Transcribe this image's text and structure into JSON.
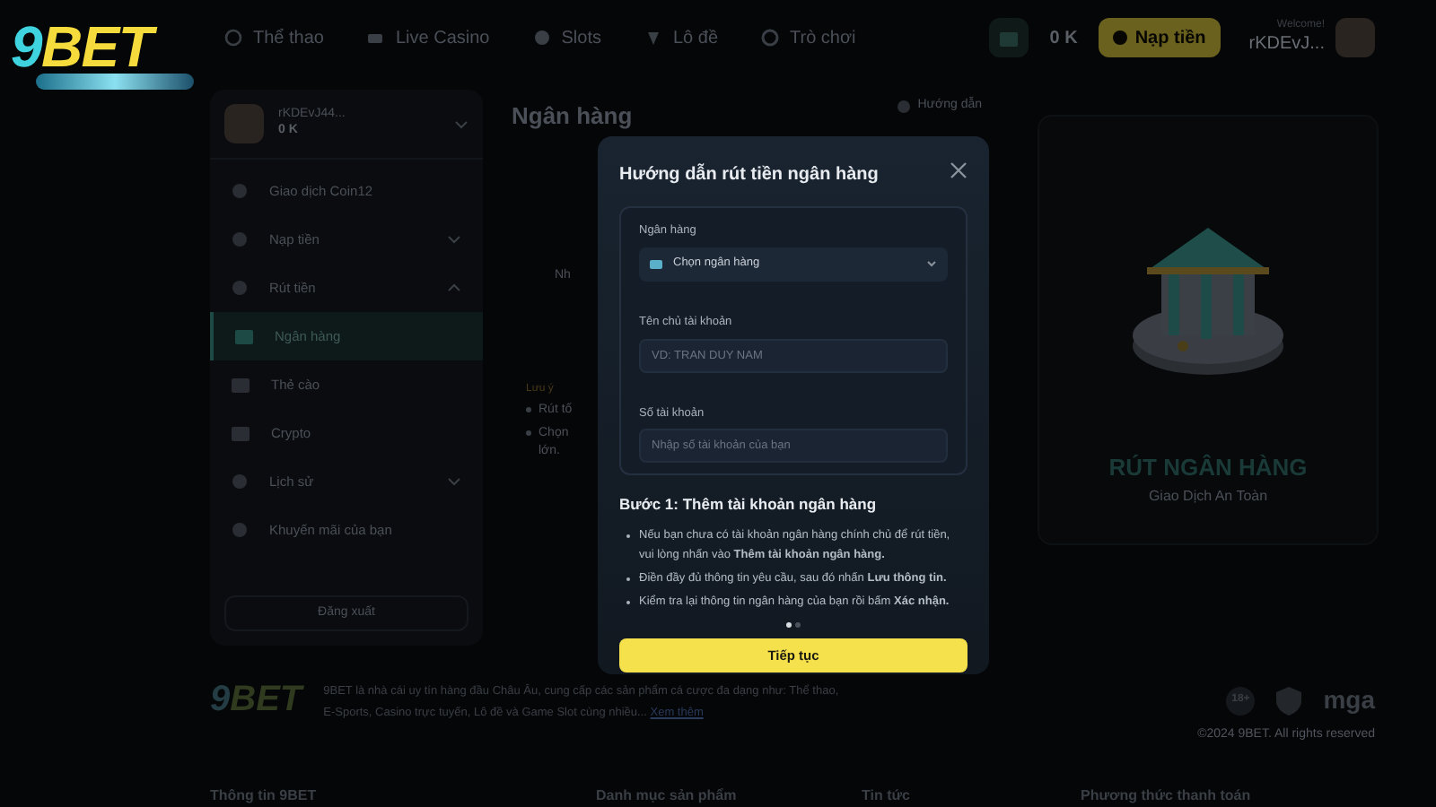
{
  "logo": {
    "mark": "9",
    "word": "BET"
  },
  "header": {
    "nav": [
      {
        "label": "Thể thao"
      },
      {
        "label": "Live Casino"
      },
      {
        "label": "Slots"
      },
      {
        "label": "Lô đề"
      },
      {
        "label": "Trò chơi"
      }
    ],
    "balance": "0 K",
    "deposit_button": "Nạp tiền",
    "welcome": "Welcome!",
    "username": "rKDEvJ..."
  },
  "sidebar": {
    "user": {
      "name": "rKDEvJ44...",
      "balance": "0 K"
    },
    "items": [
      {
        "kind": "link",
        "label": "Giao dịch Coin12"
      },
      {
        "kind": "group",
        "label": "Nạp tiền",
        "expanded": false
      },
      {
        "kind": "group",
        "label": "Rút tiền",
        "expanded": true,
        "children": [
          {
            "label": "Ngân hàng",
            "selected": true
          },
          {
            "label": "Thẻ cào",
            "selected": false
          },
          {
            "label": "Crypto",
            "selected": false
          }
        ]
      },
      {
        "kind": "group",
        "label": "Lịch sử",
        "expanded": false
      },
      {
        "kind": "link",
        "label": "Khuyến mãi của bạn"
      }
    ],
    "logout": "Đăng xuất"
  },
  "main": {
    "title": "Ngân hàng",
    "guide_link": "Hướng dẫn",
    "hint": "Nh",
    "note_title": "Lưu ý",
    "notes": [
      {
        "lines": [
          "Rút tố"
        ]
      },
      {
        "lines": [
          "Chọn",
          "lớn."
        ]
      }
    ],
    "promo": {
      "title": "RÚT NGÂN HÀNG",
      "subtitle": "Giao Dịch An Toàn"
    }
  },
  "modal": {
    "title": "Hướng dẫn rút tiền ngân hàng",
    "fields": [
      {
        "kind": "select",
        "label": "Ngân hàng",
        "placeholder": "Chọn ngân hàng"
      },
      {
        "kind": "input",
        "label": "Tên chủ tài khoản",
        "placeholder": "VD: TRAN DUY NAM"
      },
      {
        "kind": "input",
        "label": "Số tài khoản",
        "placeholder": "Nhập số tài khoản của bạn"
      }
    ],
    "step_title": "Bước 1: Thêm tài khoản ngân hàng",
    "steps": [
      "Nếu bạn chưa có tài khoản ngân hàng chính chủ để rút tiền, vui lòng nhấn vào **Thêm tài khoản ngân hàng.**",
      "Điền đầy đủ thông tin yêu cầu, sau đó nhấn **Lưu thông tin.**",
      "Kiểm tra lại thông tin ngân hàng của bạn rồi bấm **Xác nhận.**"
    ],
    "pages": [
      {
        "selected": true
      },
      {
        "selected": false
      }
    ],
    "button": "Tiếp tục"
  },
  "footer": {
    "logo": {
      "mark": "9",
      "word": "BET"
    },
    "description": "9BET là nhà cái uy tín hàng đầu Châu Âu, cung cấp các sản phẩm cá cược đa dạng như: Thể thao, E-Sports, Casino trực tuyến, Lô đề và Game Slot cùng nhiều...",
    "more_link": "Xem thêm",
    "age_badge": "18+",
    "license": "mga",
    "copyright": "©2024 9BET. All rights reserved",
    "columns": [
      "Thông tin 9BET",
      "Danh mục sản phẩm",
      "Tin tức",
      "Phương thức thanh toán"
    ]
  }
}
